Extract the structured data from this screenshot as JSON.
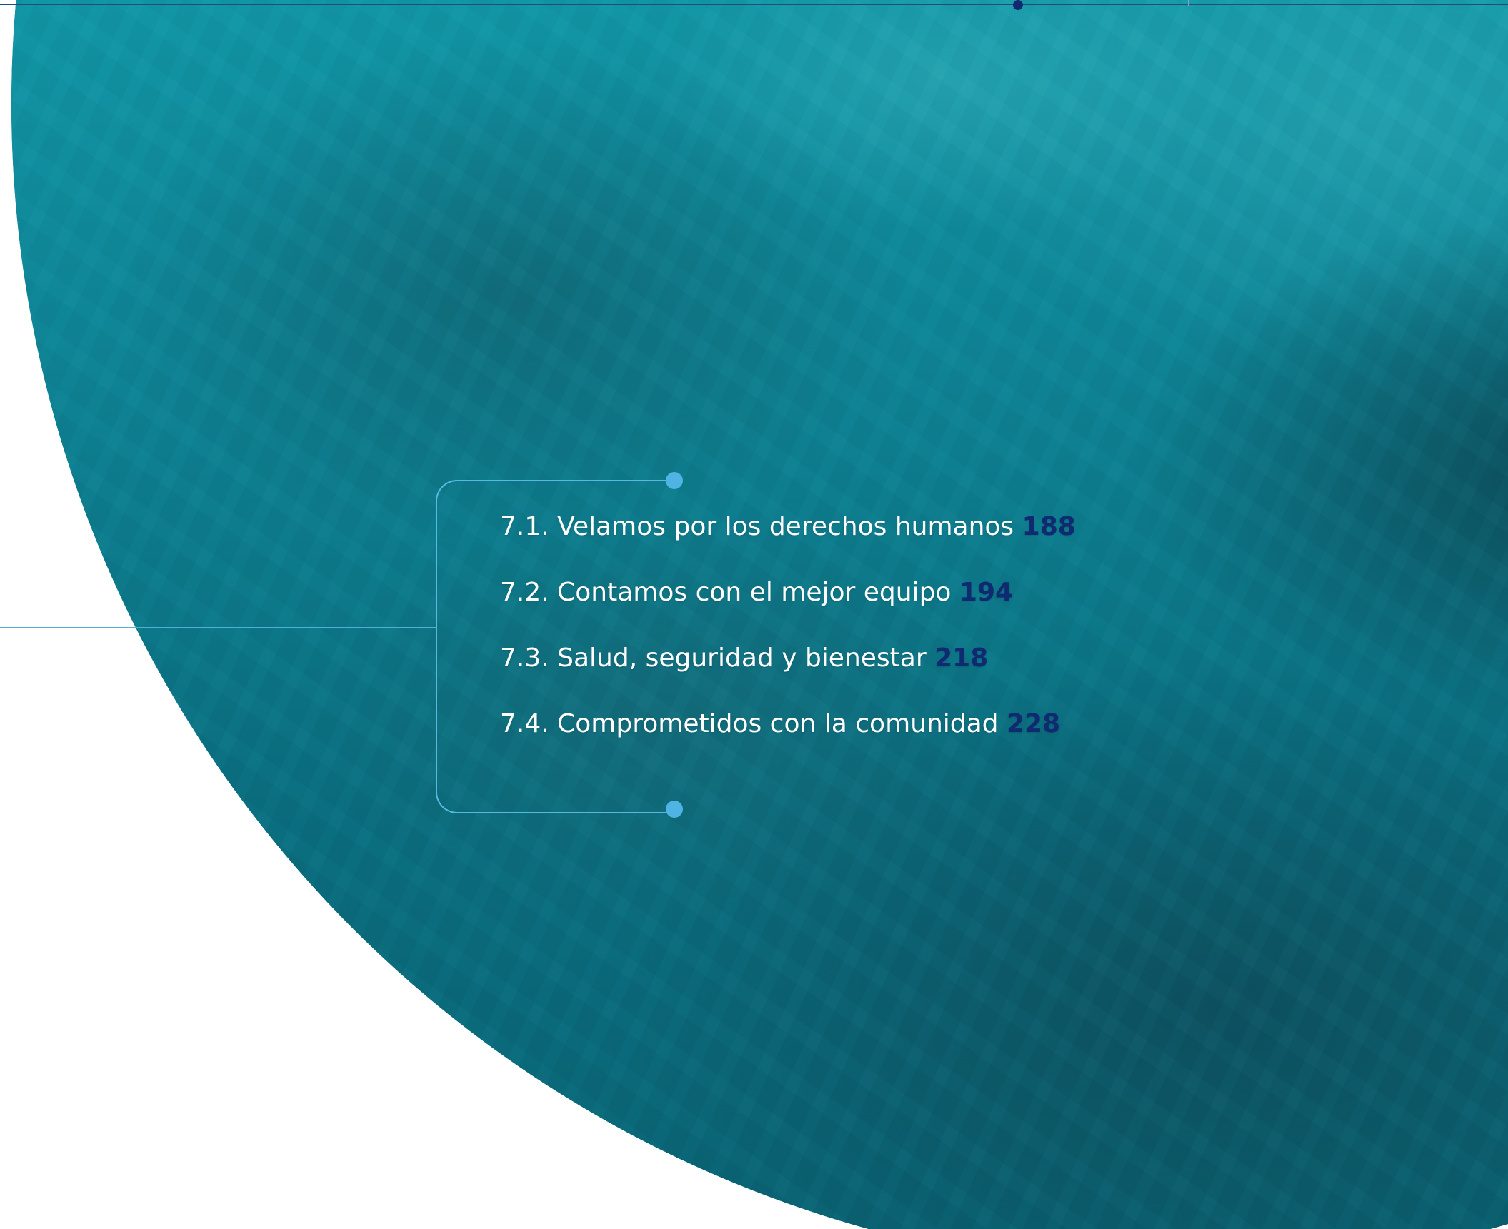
{
  "toc": {
    "items": [
      {
        "label": "7.1. Velamos por los derechos humanos",
        "page": "188"
      },
      {
        "label": "7.2. Contamos con el mejor equipo",
        "page": "194"
      },
      {
        "label": "7.3. Salud, seguridad y bienestar",
        "page": "218"
      },
      {
        "label": "7.4. Comprometidos con la comunidad",
        "page": "228"
      }
    ]
  },
  "colors": {
    "water": "#1296a6",
    "accent_line": "#5ab8e0",
    "page_number": "#0f2a70",
    "text": "#ffffff"
  }
}
